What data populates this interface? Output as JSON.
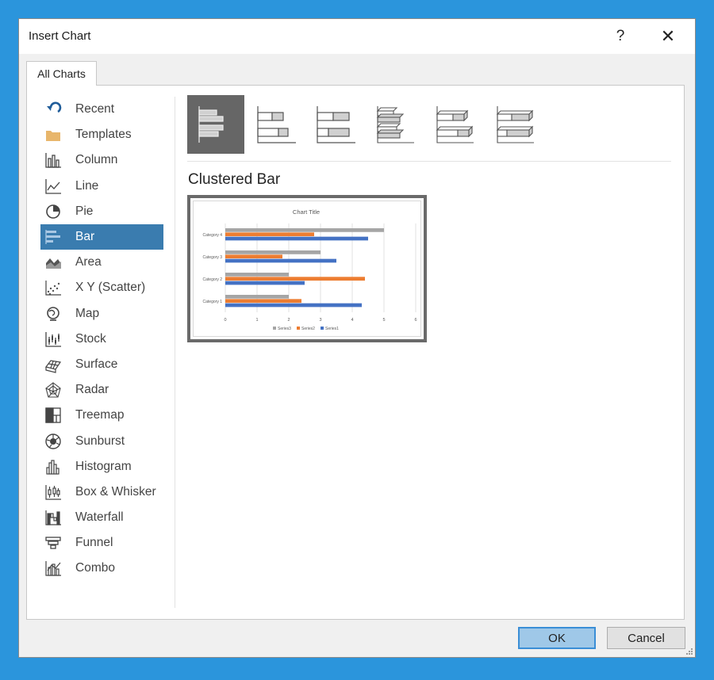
{
  "dialog": {
    "title": "Insert Chart",
    "help_label": "?",
    "close_label": "✕"
  },
  "tabs": [
    {
      "label": "All Charts"
    }
  ],
  "categories": [
    {
      "label": "Recent",
      "icon": "recent-icon"
    },
    {
      "label": "Templates",
      "icon": "templates-icon"
    },
    {
      "label": "Column",
      "icon": "column-chart-icon"
    },
    {
      "label": "Line",
      "icon": "line-chart-icon"
    },
    {
      "label": "Pie",
      "icon": "pie-chart-icon"
    },
    {
      "label": "Bar",
      "icon": "bar-chart-icon",
      "selected": true
    },
    {
      "label": "Area",
      "icon": "area-chart-icon"
    },
    {
      "label": "X Y (Scatter)",
      "icon": "scatter-chart-icon"
    },
    {
      "label": "Map",
      "icon": "map-chart-icon"
    },
    {
      "label": "Stock",
      "icon": "stock-chart-icon"
    },
    {
      "label": "Surface",
      "icon": "surface-chart-icon"
    },
    {
      "label": "Radar",
      "icon": "radar-chart-icon"
    },
    {
      "label": "Treemap",
      "icon": "treemap-chart-icon"
    },
    {
      "label": "Sunburst",
      "icon": "sunburst-chart-icon"
    },
    {
      "label": "Histogram",
      "icon": "histogram-chart-icon"
    },
    {
      "label": "Box & Whisker",
      "icon": "box-whisker-chart-icon"
    },
    {
      "label": "Waterfall",
      "icon": "waterfall-chart-icon"
    },
    {
      "label": "Funnel",
      "icon": "funnel-chart-icon"
    },
    {
      "label": "Combo",
      "icon": "combo-chart-icon"
    }
  ],
  "subtypes": [
    {
      "icon": "clustered-bar-icon",
      "selected": true
    },
    {
      "icon": "stacked-bar-icon"
    },
    {
      "icon": "100-stacked-bar-icon"
    },
    {
      "icon": "3d-clustered-bar-icon"
    },
    {
      "icon": "3d-stacked-bar-icon"
    },
    {
      "icon": "3d-100-stacked-bar-icon"
    }
  ],
  "selected_subtype_title": "Clustered Bar",
  "chart_data": {
    "type": "bar",
    "orientation": "horizontal",
    "title": "Chart Title",
    "categories": [
      "Category 1",
      "Category 2",
      "Category 3",
      "Category 4"
    ],
    "series": [
      {
        "name": "Series1",
        "values": [
          4.3,
          2.5,
          3.5,
          4.5
        ],
        "color": "#4472c4"
      },
      {
        "name": "Series2",
        "values": [
          2.4,
          4.4,
          1.8,
          2.8
        ],
        "color": "#ed7d31"
      },
      {
        "name": "Series3",
        "values": [
          2,
          2,
          3,
          5
        ],
        "color": "#a5a5a5"
      }
    ],
    "xticks": [
      "0",
      "1",
      "2",
      "3",
      "4",
      "5",
      "6"
    ],
    "xlim": [
      0,
      6
    ],
    "grid": true,
    "legend_position": "bottom"
  },
  "buttons": {
    "ok": "OK",
    "cancel": "Cancel"
  },
  "colors": {
    "accent": "#2b95dc",
    "selection": "#3a7caf"
  }
}
